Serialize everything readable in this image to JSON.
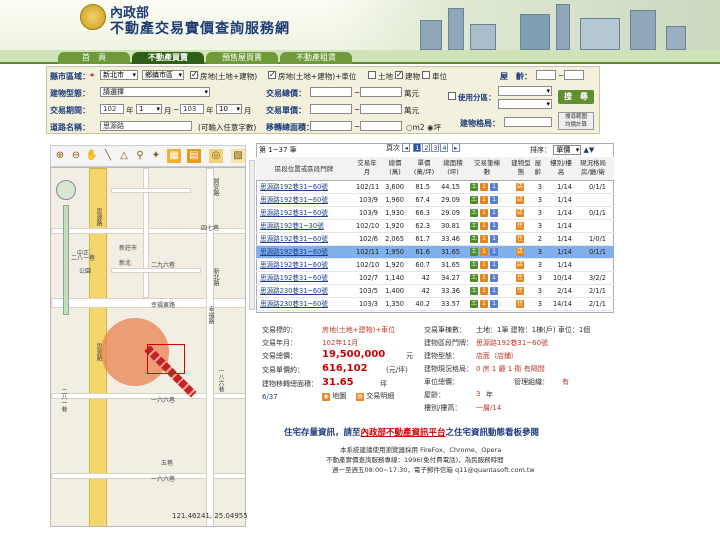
{
  "header": {
    "title_org": "內政部",
    "title_main": "不動產交易實價查詢服務網"
  },
  "tabs": [
    "首　頁",
    "不動產買賣",
    "預售屋買賣",
    "不動產租賃"
  ],
  "form": {
    "county_label": "縣市區域：",
    "county_value": "新北市",
    "district_value": "鄉鎮市區",
    "checks": [
      "房地(土地+建物)",
      "房地(土地+建物)+車位",
      "土地",
      "建物",
      "車位"
    ],
    "floor_label": "屋　齡：",
    "type_label": "建物型態：",
    "type_value": "請選擇",
    "period_label": "交易期間：",
    "from_year": "102",
    "from_month": "1",
    "to_year": "103",
    "to_month": "10",
    "year_unit": "年",
    "month_unit": "月",
    "tilde": "~",
    "total_label": "交易總價：",
    "total_unit": "萬元",
    "unit_label": "交易單價：",
    "unit_unit": "萬元",
    "zone_label": "使用分區：",
    "road_label": "道路名稱：",
    "road_value": "思源路",
    "road_hint": "(可輸入任意字數)",
    "area_label": "移轉總面積：",
    "area_m2": "m2",
    "area_ping": "坪",
    "layout_label": "建物格局：",
    "search_btn": "搜　尋",
    "calc_btn": "搜尋範圍\n均價計算"
  },
  "map": {
    "labels": [
      "思源路",
      "新莊市",
      "幸福東路",
      "思源路",
      "興安路",
      "中正",
      "幸福路",
      "新北",
      "二八一巷",
      "新北路",
      "二九六巷",
      "公園",
      "一六六巷",
      "五巷",
      "二八一巷",
      "四七巷",
      "一八六巷",
      "一六六巷"
    ],
    "coords": "121.46241, 25.04955"
  },
  "results": {
    "range": "第 1~37 筆",
    "page_label": "頁次",
    "pages": [
      "1",
      "2",
      "3",
      "4"
    ],
    "sort_label": "排序：",
    "sort_value": "單價",
    "headers": [
      "區段位置或區段門牌",
      "交易年月",
      "總價(萬)",
      "單價(萬/坪)",
      "總面積(坪)",
      "交易筆棟數",
      "建物型態",
      "屋齡",
      "樓別/樓高",
      "現況格局房/廳/衛"
    ],
    "rows": [
      {
        "addr": "思源路192巷31~60號",
        "ym": "102/11",
        "total": "3,600",
        "unit": "81.5",
        "area": "44.15",
        "icons": [
          "土",
          "1",
          "1"
        ],
        "type": "店",
        "age": "3",
        "floor": "1/14",
        "layout": "0/1/1"
      },
      {
        "addr": "思源路192巷31~60號",
        "ym": "103/9",
        "total": "1,960",
        "unit": "67.4",
        "area": "29.09",
        "icons": [
          "土",
          "1",
          "1"
        ],
        "type": "店",
        "age": "3",
        "floor": "1/14",
        "layout": ""
      },
      {
        "addr": "思源路192巷31~60號",
        "ym": "103/9",
        "total": "1,930",
        "unit": "66.3",
        "area": "29.09",
        "icons": [
          "土",
          "1",
          "1"
        ],
        "type": "店",
        "age": "3",
        "floor": "1/14",
        "layout": "0/1/1"
      },
      {
        "addr": "思源路192巷1~30號",
        "ym": "102/10",
        "total": "1,920",
        "unit": "62.3",
        "area": "30.81",
        "icons": [
          "土",
          "1",
          "1"
        ],
        "type": "住",
        "age": "3",
        "floor": "1/14",
        "layout": ""
      },
      {
        "addr": "思源路192巷31~60號",
        "ym": "102/6",
        "total": "2,065",
        "unit": "61.7",
        "area": "33.46",
        "icons": [
          "土",
          "1",
          "1"
        ],
        "type": "住",
        "age": "2",
        "floor": "1/14",
        "layout": "1/0/1"
      },
      {
        "addr": "思源路192巷31~60號",
        "ym": "102/11",
        "total": "1,950",
        "unit": "61.6",
        "area": "31.65",
        "icons": [
          "土",
          "1",
          "1"
        ],
        "type": "店",
        "age": "3",
        "floor": "1/14",
        "layout": "0/1/1"
      },
      {
        "addr": "思源路192巷31~60號",
        "ym": "102/10",
        "total": "1,920",
        "unit": "60.7",
        "area": "31.65",
        "icons": [
          "土",
          "1",
          "1"
        ],
        "type": "店",
        "age": "3",
        "floor": "1/14",
        "layout": ""
      },
      {
        "addr": "思源路192巷31~60號",
        "ym": "102/7",
        "total": "1,140",
        "unit": "42",
        "area": "34.27",
        "icons": [
          "土",
          "1",
          "1"
        ],
        "type": "住",
        "age": "3",
        "floor": "10/14",
        "layout": "3/2/2"
      },
      {
        "addr": "思源路230巷31~60號",
        "ym": "103/5",
        "total": "1,400",
        "unit": "42",
        "area": "33.36",
        "icons": [
          "土",
          "1",
          "1"
        ],
        "type": "住",
        "age": "3",
        "floor": "2/14",
        "layout": "2/1/1"
      },
      {
        "addr": "思源路230巷31~60號",
        "ym": "103/3",
        "total": "1,350",
        "unit": "40.2",
        "area": "33.57",
        "icons": [
          "土",
          "1",
          "1"
        ],
        "type": "住",
        "age": "3",
        "floor": "14/14",
        "layout": "2/1/1"
      }
    ]
  },
  "detail": {
    "kind_label": "交易標的：",
    "kind_value": "房地(土地+建物)+車位",
    "count_label": "交易筆棟數：",
    "count_value": "土地：1筆 建物：1棟(戶) 車位：1個",
    "ym_label": "交易年月：",
    "ym_value": "102年11月",
    "addr_label": "建物區段門牌：",
    "addr_value": "思源路192巷31~60號",
    "total_label": "交易總價：",
    "total_value": "19,500,000",
    "total_unit": "元",
    "btype_label": "建物型態：",
    "btype_value": "店面（店鋪）",
    "unit_label": "交易單價約：",
    "unit_value": "616,102",
    "unit_unit": "(元/坪)",
    "layout_label": "建物現況格局：",
    "layout_value": "0 房 1 廳 1 衛 有隔間",
    "area_label": "建物移轉總面積：",
    "area_value": "31.65",
    "area_unit": "坪",
    "parking_label": "車位總價：",
    "mgmt_label": "管理組織：",
    "mgmt_value": "有",
    "age_label": "屋齡：",
    "age_value": "3",
    "age_unit": "年",
    "floor_label": "樓別/樓高：",
    "floor_value": "一層/14",
    "index": "6/37",
    "map_link": "地圖",
    "detail_link": "交易明細"
  },
  "footer": {
    "promo_pre": "住宅存量資訊，請至",
    "promo_link": "內政部不動產資訊平台",
    "promo_post": "之住宅資訊動態看板參閱",
    "line1": "本系統建議使用瀏覽器採用 FireFox、Chrome、Opera",
    "line2": "不動產實價查詢服務專線：1996(免付費電話)，為民服務時間",
    "line3": "週一至週五08:00~17:30，電子郵件信箱 q11@quantasoft.com.tw"
  }
}
